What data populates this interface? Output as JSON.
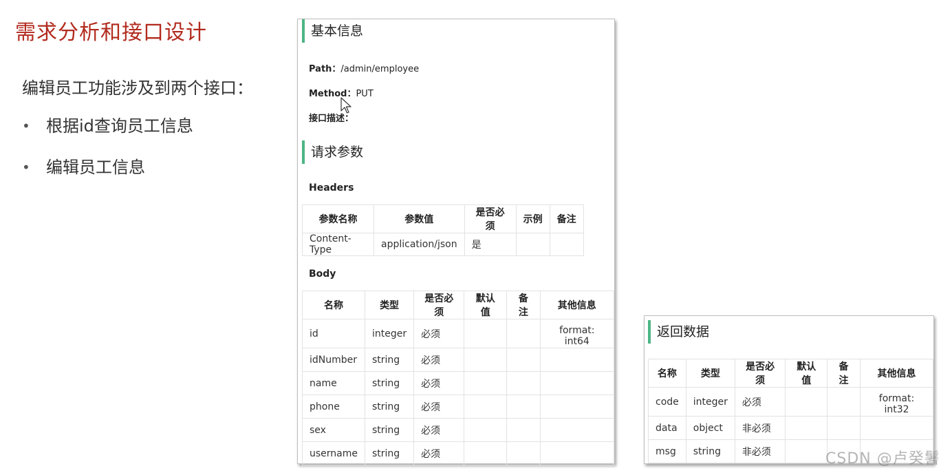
{
  "slide": {
    "title": "需求分析和接口设计",
    "intro": "编辑员工功能涉及到两个接口：",
    "bullets": [
      {
        "bullet": "•",
        "text": "根据id查询员工信息"
      },
      {
        "bullet": "•",
        "text": "编辑员工信息"
      }
    ]
  },
  "api": {
    "basic_title": "基本信息",
    "path_label": "Path：",
    "path_value": "/admin/employee",
    "method_label": "Method：",
    "method_value": "PUT",
    "desc_label": "接口描述：",
    "params_title": "请求参数",
    "headers_label": "Headers",
    "headers_table": {
      "columns": [
        "参数名称",
        "参数值",
        "是否必须",
        "示例",
        "备注"
      ],
      "rows": [
        [
          "Content-Type",
          "application/json",
          "是",
          "",
          ""
        ]
      ]
    },
    "body_label": "Body",
    "body_table": {
      "columns": [
        "名称",
        "类型",
        "是否必须",
        "默认值",
        "备注",
        "其他信息"
      ],
      "rows": [
        [
          "id",
          "integer",
          "必须",
          "",
          "",
          "format: int64"
        ],
        [
          "idNumber",
          "string",
          "必须",
          "",
          "",
          ""
        ],
        [
          "name",
          "string",
          "必须",
          "",
          "",
          ""
        ],
        [
          "phone",
          "string",
          "必须",
          "",
          "",
          ""
        ],
        [
          "sex",
          "string",
          "必须",
          "",
          "",
          ""
        ],
        [
          "username",
          "string",
          "必须",
          "",
          "",
          ""
        ]
      ]
    }
  },
  "response": {
    "title": "返回数据",
    "table": {
      "columns": [
        "名称",
        "类型",
        "是否必须",
        "默认值",
        "备注",
        "其他信息"
      ],
      "rows": [
        [
          "code",
          "integer",
          "必须",
          "",
          "",
          "format: int32"
        ],
        [
          "data",
          "object",
          "非必须",
          "",
          "",
          ""
        ],
        [
          "msg",
          "string",
          "非必须",
          "",
          "",
          ""
        ]
      ]
    }
  },
  "watermark": "CSDN @卢癸鬐",
  "colors": {
    "title_red": "#b22a1e",
    "accent_green": "#4cb585"
  },
  "icons": {
    "cursor": "mouse-pointer-icon"
  }
}
